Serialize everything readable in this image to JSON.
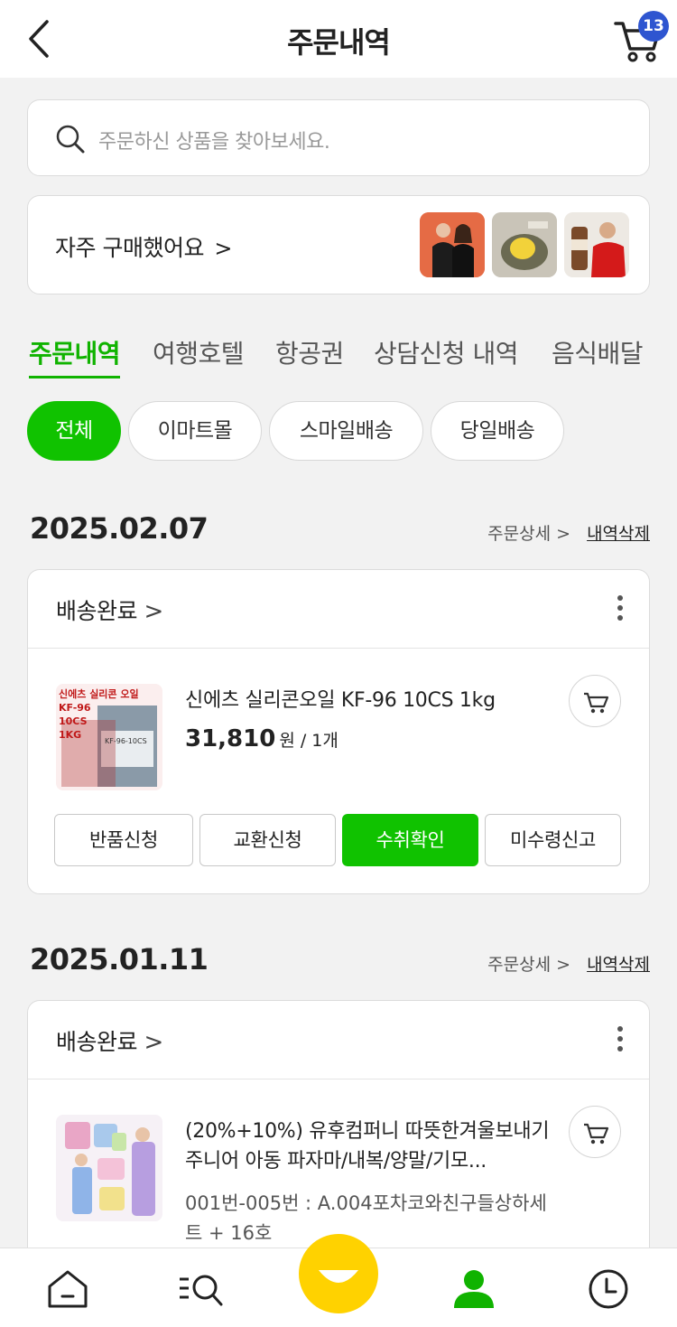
{
  "header": {
    "title": "주문내역",
    "cart_count": "13"
  },
  "search": {
    "placeholder": "주문하신 상품을 찾아보세요."
  },
  "frequent": {
    "label": "자주 구매했어요",
    "chevron": ">"
  },
  "tabs": [
    "주문내역",
    "여행호텔",
    "항공권",
    "상담신청 내역",
    "음식배달"
  ],
  "filters": [
    "전체",
    "이마트몰",
    "스마일배송",
    "당일배송"
  ],
  "orders": [
    {
      "date": "2025.02.07",
      "detail_link": "주문상세 >",
      "delete_link": "내역삭제",
      "status": "배송완료",
      "product_name": "신에츠 실리콘오일 KF-96 10CS 1kg",
      "price": "31,810",
      "price_unit": "원 / 1개",
      "image_text": [
        "신에츠 실리콘 오일",
        "KF-96",
        "10CS",
        "1KG",
        "KF-96-10CS"
      ],
      "buttons": [
        "반품신청",
        "교환신청",
        "수취확인",
        "미수령신고"
      ]
    },
    {
      "date": "2025.01.11",
      "detail_link": "주문상세 >",
      "delete_link": "내역삭제",
      "status": "배송완료",
      "product_name": "(20%+10%) 유후컴퍼니 따뜻한겨울보내기 주니어 아동 파자마/내복/양말/기모...",
      "option": "001번-005번 : A.004포차코와친구들상하세트 + 16호"
    }
  ],
  "colors": {
    "accent": "#10c200",
    "badge": "#2e55d0",
    "center": "#ffd200"
  },
  "nav": {
    "icons": [
      "home-icon",
      "search-menu-icon",
      "smile-icon",
      "my-page-icon",
      "recent-icon"
    ]
  }
}
